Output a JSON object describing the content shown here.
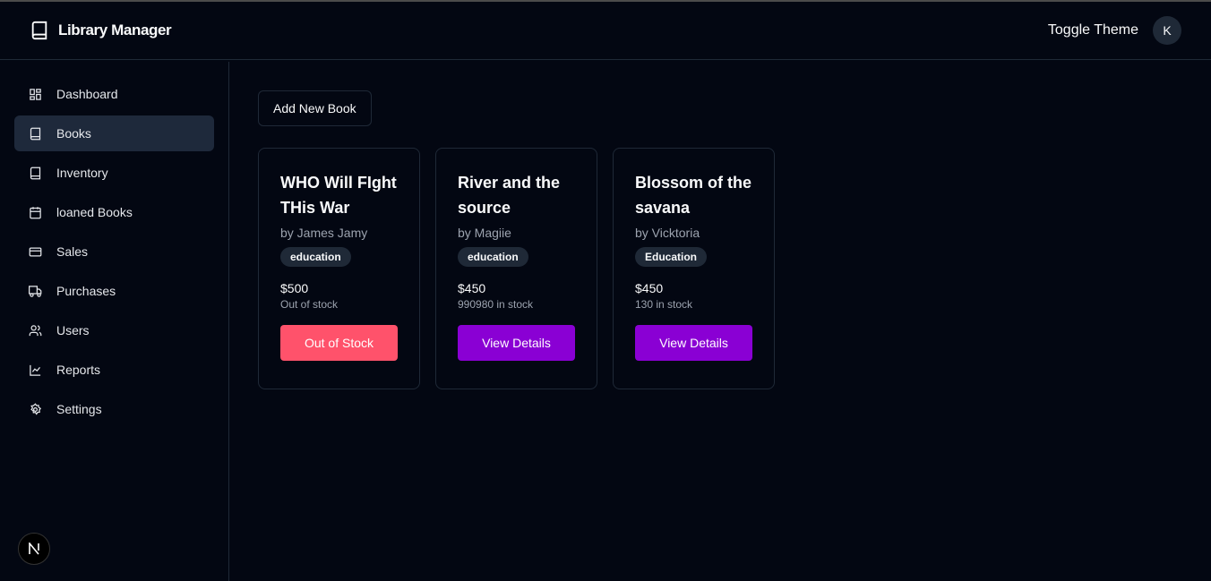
{
  "header": {
    "title": "Library Manager",
    "toggle_theme": "Toggle Theme",
    "avatar": "K"
  },
  "sidebar": {
    "items": [
      {
        "label": "Dashboard",
        "icon": "dashboard-icon"
      },
      {
        "label": "Books",
        "icon": "book-icon"
      },
      {
        "label": "Inventory",
        "icon": "book-icon"
      },
      {
        "label": "loaned Books",
        "icon": "calendar-icon"
      },
      {
        "label": "Sales",
        "icon": "credit-card-icon"
      },
      {
        "label": "Purchases",
        "icon": "truck-icon"
      },
      {
        "label": "Users",
        "icon": "users-icon"
      },
      {
        "label": "Reports",
        "icon": "chart-icon"
      },
      {
        "label": "Settings",
        "icon": "gear-icon"
      }
    ]
  },
  "main": {
    "add_button": "Add New Book",
    "books": [
      {
        "title": "WHO Will FIght THis War",
        "author": "by James Jamy",
        "category": "education",
        "price": "$500",
        "stock": "Out of stock",
        "action": "Out of Stock"
      },
      {
        "title": "River and the source",
        "author": "by Magiie",
        "category": "education",
        "price": "$450",
        "stock": "990980 in stock",
        "action": "View Details"
      },
      {
        "title": "Blossom of the savana",
        "author": "by Vicktoria",
        "category": "Education",
        "price": "$450",
        "stock": "130 in stock",
        "action": "View Details"
      }
    ]
  },
  "colors": {
    "out_of_stock": "#ff526b",
    "view_details": "#8a00d4"
  }
}
